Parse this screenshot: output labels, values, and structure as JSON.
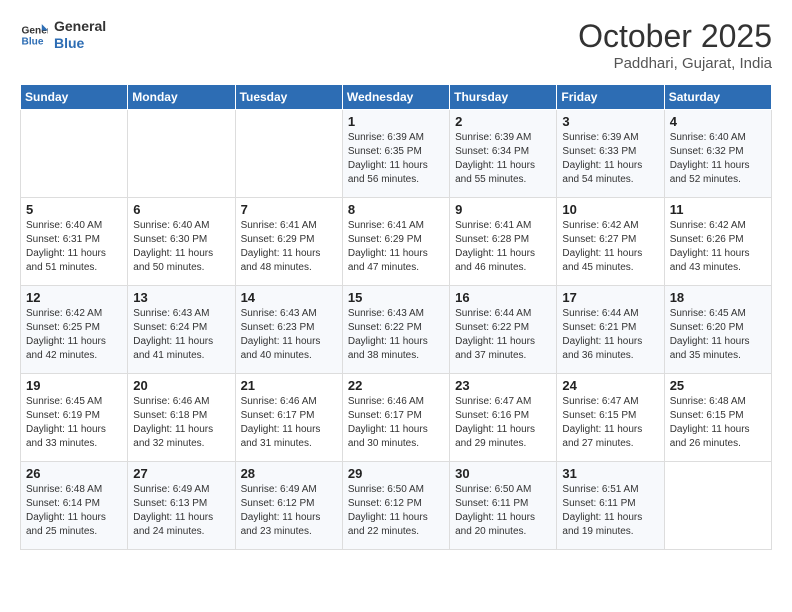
{
  "header": {
    "logo_line1": "General",
    "logo_line2": "Blue",
    "month": "October 2025",
    "location": "Paddhari, Gujarat, India"
  },
  "weekdays": [
    "Sunday",
    "Monday",
    "Tuesday",
    "Wednesday",
    "Thursday",
    "Friday",
    "Saturday"
  ],
  "weeks": [
    [
      {
        "day": "",
        "info": ""
      },
      {
        "day": "",
        "info": ""
      },
      {
        "day": "",
        "info": ""
      },
      {
        "day": "1",
        "info": "Sunrise: 6:39 AM\nSunset: 6:35 PM\nDaylight: 11 hours\nand 56 minutes."
      },
      {
        "day": "2",
        "info": "Sunrise: 6:39 AM\nSunset: 6:34 PM\nDaylight: 11 hours\nand 55 minutes."
      },
      {
        "day": "3",
        "info": "Sunrise: 6:39 AM\nSunset: 6:33 PM\nDaylight: 11 hours\nand 54 minutes."
      },
      {
        "day": "4",
        "info": "Sunrise: 6:40 AM\nSunset: 6:32 PM\nDaylight: 11 hours\nand 52 minutes."
      }
    ],
    [
      {
        "day": "5",
        "info": "Sunrise: 6:40 AM\nSunset: 6:31 PM\nDaylight: 11 hours\nand 51 minutes."
      },
      {
        "day": "6",
        "info": "Sunrise: 6:40 AM\nSunset: 6:30 PM\nDaylight: 11 hours\nand 50 minutes."
      },
      {
        "day": "7",
        "info": "Sunrise: 6:41 AM\nSunset: 6:29 PM\nDaylight: 11 hours\nand 48 minutes."
      },
      {
        "day": "8",
        "info": "Sunrise: 6:41 AM\nSunset: 6:29 PM\nDaylight: 11 hours\nand 47 minutes."
      },
      {
        "day": "9",
        "info": "Sunrise: 6:41 AM\nSunset: 6:28 PM\nDaylight: 11 hours\nand 46 minutes."
      },
      {
        "day": "10",
        "info": "Sunrise: 6:42 AM\nSunset: 6:27 PM\nDaylight: 11 hours\nand 45 minutes."
      },
      {
        "day": "11",
        "info": "Sunrise: 6:42 AM\nSunset: 6:26 PM\nDaylight: 11 hours\nand 43 minutes."
      }
    ],
    [
      {
        "day": "12",
        "info": "Sunrise: 6:42 AM\nSunset: 6:25 PM\nDaylight: 11 hours\nand 42 minutes."
      },
      {
        "day": "13",
        "info": "Sunrise: 6:43 AM\nSunset: 6:24 PM\nDaylight: 11 hours\nand 41 minutes."
      },
      {
        "day": "14",
        "info": "Sunrise: 6:43 AM\nSunset: 6:23 PM\nDaylight: 11 hours\nand 40 minutes."
      },
      {
        "day": "15",
        "info": "Sunrise: 6:43 AM\nSunset: 6:22 PM\nDaylight: 11 hours\nand 38 minutes."
      },
      {
        "day": "16",
        "info": "Sunrise: 6:44 AM\nSunset: 6:22 PM\nDaylight: 11 hours\nand 37 minutes."
      },
      {
        "day": "17",
        "info": "Sunrise: 6:44 AM\nSunset: 6:21 PM\nDaylight: 11 hours\nand 36 minutes."
      },
      {
        "day": "18",
        "info": "Sunrise: 6:45 AM\nSunset: 6:20 PM\nDaylight: 11 hours\nand 35 minutes."
      }
    ],
    [
      {
        "day": "19",
        "info": "Sunrise: 6:45 AM\nSunset: 6:19 PM\nDaylight: 11 hours\nand 33 minutes."
      },
      {
        "day": "20",
        "info": "Sunrise: 6:46 AM\nSunset: 6:18 PM\nDaylight: 11 hours\nand 32 minutes."
      },
      {
        "day": "21",
        "info": "Sunrise: 6:46 AM\nSunset: 6:17 PM\nDaylight: 11 hours\nand 31 minutes."
      },
      {
        "day": "22",
        "info": "Sunrise: 6:46 AM\nSunset: 6:17 PM\nDaylight: 11 hours\nand 30 minutes."
      },
      {
        "day": "23",
        "info": "Sunrise: 6:47 AM\nSunset: 6:16 PM\nDaylight: 11 hours\nand 29 minutes."
      },
      {
        "day": "24",
        "info": "Sunrise: 6:47 AM\nSunset: 6:15 PM\nDaylight: 11 hours\nand 27 minutes."
      },
      {
        "day": "25",
        "info": "Sunrise: 6:48 AM\nSunset: 6:15 PM\nDaylight: 11 hours\nand 26 minutes."
      }
    ],
    [
      {
        "day": "26",
        "info": "Sunrise: 6:48 AM\nSunset: 6:14 PM\nDaylight: 11 hours\nand 25 minutes."
      },
      {
        "day": "27",
        "info": "Sunrise: 6:49 AM\nSunset: 6:13 PM\nDaylight: 11 hours\nand 24 minutes."
      },
      {
        "day": "28",
        "info": "Sunrise: 6:49 AM\nSunset: 6:12 PM\nDaylight: 11 hours\nand 23 minutes."
      },
      {
        "day": "29",
        "info": "Sunrise: 6:50 AM\nSunset: 6:12 PM\nDaylight: 11 hours\nand 22 minutes."
      },
      {
        "day": "30",
        "info": "Sunrise: 6:50 AM\nSunset: 6:11 PM\nDaylight: 11 hours\nand 20 minutes."
      },
      {
        "day": "31",
        "info": "Sunrise: 6:51 AM\nSunset: 6:11 PM\nDaylight: 11 hours\nand 19 minutes."
      },
      {
        "day": "",
        "info": ""
      }
    ]
  ]
}
